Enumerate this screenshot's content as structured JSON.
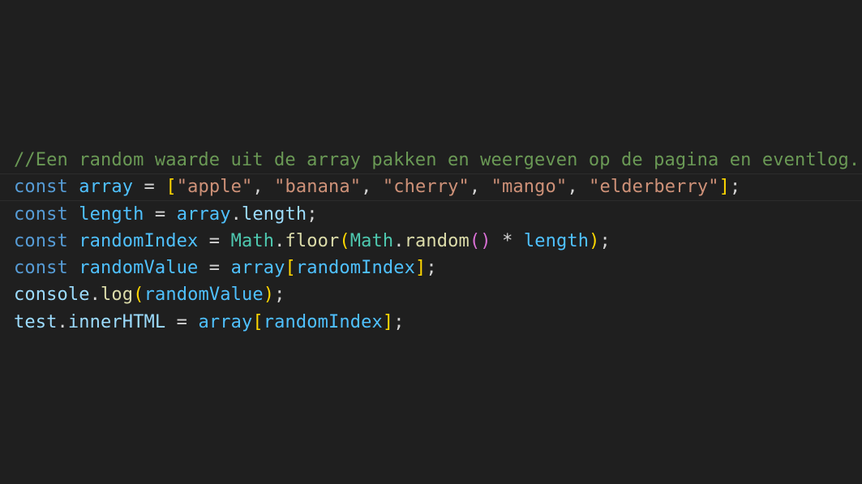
{
  "editor": {
    "lines": [
      {
        "tokens": [
          {
            "text": "//Een random waarde uit de array pakken en weergeven op de pagina en eventlog.",
            "kind": "comment"
          }
        ]
      },
      {
        "current": true,
        "tokens": [
          {
            "text": "const",
            "kind": "keyword"
          },
          {
            "text": " ",
            "kind": "plain"
          },
          {
            "text": "array",
            "kind": "const-var"
          },
          {
            "text": " = ",
            "kind": "plain"
          },
          {
            "text": "[",
            "kind": "b1"
          },
          {
            "text": "\"apple\"",
            "kind": "string"
          },
          {
            "text": ", ",
            "kind": "plain"
          },
          {
            "text": "\"banana\"",
            "kind": "string"
          },
          {
            "text": ", ",
            "kind": "plain"
          },
          {
            "text": "\"cherry\"",
            "kind": "string"
          },
          {
            "text": ", ",
            "kind": "plain"
          },
          {
            "text": "\"mango\"",
            "kind": "string"
          },
          {
            "text": ", ",
            "kind": "plain"
          },
          {
            "text": "\"elderberry\"",
            "kind": "string"
          },
          {
            "text": "]",
            "kind": "b1"
          },
          {
            "text": ";",
            "kind": "plain"
          }
        ]
      },
      {
        "tokens": [
          {
            "text": "const",
            "kind": "keyword"
          },
          {
            "text": " ",
            "kind": "plain"
          },
          {
            "text": "length",
            "kind": "const-var"
          },
          {
            "text": " = ",
            "kind": "plain"
          },
          {
            "text": "array",
            "kind": "const-var"
          },
          {
            "text": ".",
            "kind": "plain"
          },
          {
            "text": "length",
            "kind": "variable"
          },
          {
            "text": ";",
            "kind": "plain"
          }
        ]
      },
      {
        "tokens": [
          {
            "text": "const",
            "kind": "keyword"
          },
          {
            "text": " ",
            "kind": "plain"
          },
          {
            "text": "randomIndex",
            "kind": "const-var"
          },
          {
            "text": " = ",
            "kind": "plain"
          },
          {
            "text": "Math",
            "kind": "cls"
          },
          {
            "text": ".",
            "kind": "plain"
          },
          {
            "text": "floor",
            "kind": "fn"
          },
          {
            "text": "(",
            "kind": "b1"
          },
          {
            "text": "Math",
            "kind": "cls"
          },
          {
            "text": ".",
            "kind": "plain"
          },
          {
            "text": "random",
            "kind": "fn"
          },
          {
            "text": "()",
            "kind": "b2"
          },
          {
            "text": " * ",
            "kind": "plain"
          },
          {
            "text": "length",
            "kind": "const-var"
          },
          {
            "text": ")",
            "kind": "b1"
          },
          {
            "text": ";",
            "kind": "plain"
          }
        ]
      },
      {
        "tokens": [
          {
            "text": "const",
            "kind": "keyword"
          },
          {
            "text": " ",
            "kind": "plain"
          },
          {
            "text": "randomValue",
            "kind": "const-var"
          },
          {
            "text": " = ",
            "kind": "plain"
          },
          {
            "text": "array",
            "kind": "const-var"
          },
          {
            "text": "[",
            "kind": "b1"
          },
          {
            "text": "randomIndex",
            "kind": "const-var"
          },
          {
            "text": "]",
            "kind": "b1"
          },
          {
            "text": ";",
            "kind": "plain"
          }
        ]
      },
      {
        "tokens": [
          {
            "text": "console",
            "kind": "variable"
          },
          {
            "text": ".",
            "kind": "plain"
          },
          {
            "text": "log",
            "kind": "fn"
          },
          {
            "text": "(",
            "kind": "b1"
          },
          {
            "text": "randomValue",
            "kind": "const-var"
          },
          {
            "text": ")",
            "kind": "b1"
          },
          {
            "text": ";",
            "kind": "plain"
          }
        ]
      },
      {
        "tokens": [
          {
            "text": "test",
            "kind": "variable"
          },
          {
            "text": ".",
            "kind": "plain"
          },
          {
            "text": "innerHTML",
            "kind": "variable"
          },
          {
            "text": " = ",
            "kind": "plain"
          },
          {
            "text": "array",
            "kind": "const-var"
          },
          {
            "text": "[",
            "kind": "b1"
          },
          {
            "text": "randomIndex",
            "kind": "const-var"
          },
          {
            "text": "]",
            "kind": "b1"
          },
          {
            "text": ";",
            "kind": "plain"
          }
        ]
      }
    ]
  },
  "colors": {
    "background": "#1f1f1f",
    "comment": "#6a9955",
    "keyword": "#569cd6",
    "constant": "#4fc1ff",
    "variable": "#9cdcfe",
    "string": "#ce9178",
    "function": "#dcdcaa",
    "class": "#4ec9b0",
    "bracket_1": "#ffd700",
    "bracket_2": "#da70d6",
    "punctuation": "#d4d4d4"
  }
}
